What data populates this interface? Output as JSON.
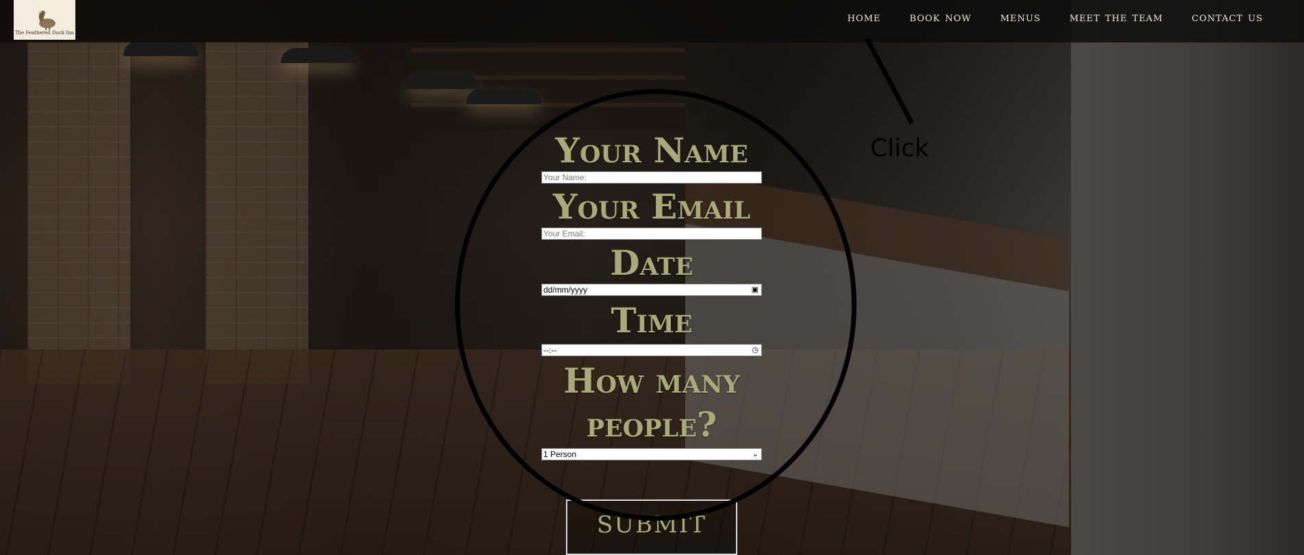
{
  "brand": {
    "logo_text": "The Feathered Duck Inn",
    "logo_icon": "duck-icon"
  },
  "nav": {
    "items": [
      "HOME",
      "BOOK NOW",
      "MENUS",
      "MEET THE TEAM",
      "CONTACT US"
    ]
  },
  "annotation": {
    "label": "Click"
  },
  "form": {
    "name_heading": "Your Name",
    "name_placeholder": "Your Name:",
    "email_heading": "Your Email",
    "email_placeholder": "Your Email:",
    "date_heading": "Date",
    "date_value": "dd/mm/yyyy",
    "time_heading": "Time",
    "time_value": "--:--",
    "people_heading_line1": "How many",
    "people_heading_line2": "people?",
    "people_selected": "1 Person",
    "submit_label": "SUBMIT"
  },
  "colors": {
    "heading": "#a9a97a",
    "nav_text": "#f0ead8",
    "header_bg": "#0c0c0c"
  }
}
